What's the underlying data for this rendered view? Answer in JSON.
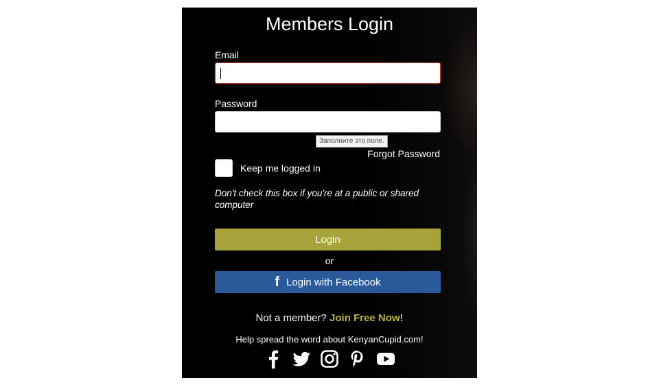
{
  "login": {
    "title": "Members Login",
    "email_label": "Email",
    "email_value": "",
    "password_label": "Password",
    "password_value": "",
    "validation_tooltip": "Заполните это поле.",
    "forgot_password": "Forgot Password",
    "keep_logged_in": "Keep me logged in",
    "keep_logged_in_checked": false,
    "public_computer_note": "Don't check this box if you're at a public or shared computer",
    "login_button": "Login",
    "or_text": "or",
    "facebook_button": "Login with Facebook",
    "not_member_text": "Not a member?",
    "join_link": "Join Free Now!",
    "spread_word": "Help spread the word about KenyanCupid.com!"
  },
  "social_icons": [
    "facebook-icon",
    "twitter-icon",
    "instagram-icon",
    "pinterest-icon",
    "youtube-icon"
  ],
  "colors": {
    "panel_background": "#000000",
    "login_button": "#a6a33a",
    "facebook_button": "#2a5a9a",
    "join_link": "#b8b446",
    "focused_border": "#c0392b",
    "text": "#ffffff"
  }
}
